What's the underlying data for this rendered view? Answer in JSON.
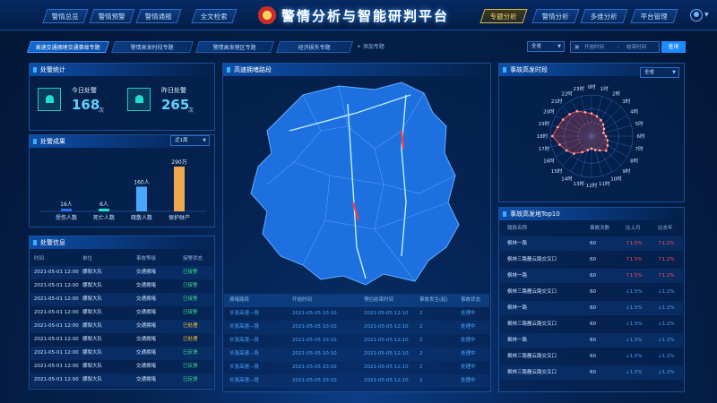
{
  "header": {
    "title": "警情分析与智能研判平台",
    "nav_left": [
      "警情总览",
      "警情预警",
      "警情通报",
      "全文检索"
    ],
    "nav_right": [
      "专题分析",
      "警情分析",
      "多维分析",
      "平台管理"
    ]
  },
  "tabs": [
    "高速交通拥堵交通事故专题",
    "警情高发时段专题",
    "警情高发辖区专题",
    "经济损失专题"
  ],
  "add_tab": "+ 添加专题",
  "filter": {
    "select": "全省",
    "start": "开始时间",
    "sep": "-",
    "end": "结束时间",
    "search": "查询"
  },
  "stats": {
    "title": "处警统计",
    "today_label": "今日处警",
    "today_value": "168",
    "today_unit": "次",
    "yesterday_label": "昨日处警",
    "yesterday_value": "265",
    "yesterday_unit": "次"
  },
  "results": {
    "title": "处警成果",
    "period": "近1周",
    "chart_data": {
      "type": "bar",
      "categories": [
        "受伤人数",
        "死亡人数",
        "疏散人数",
        "保护财产"
      ],
      "values": [
        16,
        6,
        160,
        290
      ],
      "labels": [
        "16人",
        "6人",
        "160人",
        "290万"
      ],
      "colors": [
        "#2f6df0",
        "#22e0d0",
        "#4aa6ff",
        "#f0a850"
      ]
    }
  },
  "info": {
    "title": "处警信息",
    "columns": [
      "时间",
      "单位",
      "事故等级",
      "接警状态"
    ],
    "rows": [
      [
        "2021-05-01 12:00",
        "娜梨大队",
        "交通拥堵",
        "已接警"
      ],
      [
        "2021-05-01 12:00",
        "娜梨大队",
        "交通拥堵",
        "已接警"
      ],
      [
        "2021-05-01 12:00",
        "娜梨大队",
        "交通拥堵",
        "已接警"
      ],
      [
        "2021-05-01 12:00",
        "娜梨大队",
        "交通拥堵",
        "已接警"
      ],
      [
        "2021-05-01 12:00",
        "娜梨大队",
        "交通拥堵",
        "已处理"
      ],
      [
        "2021-05-01 12:00",
        "娜梨大队",
        "交通拥堵",
        "已处理"
      ],
      [
        "2021-05-01 12:00",
        "娜梨大队",
        "交通拥堵",
        "已反馈"
      ],
      [
        "2021-05-01 12:00",
        "娜梨大队",
        "交通拥堵",
        "已反馈"
      ],
      [
        "2021-05-01 12:00",
        "娜梨大队",
        "交通拥堵",
        "已反馈"
      ]
    ],
    "status_colors": {
      "已接警": "#3ddc84",
      "已处理": "#ffcc33",
      "已反馈": "#3ddc84"
    }
  },
  "map": {
    "title": "高速拥堵路段",
    "columns": [
      "拥堵路段",
      "开始时间",
      "预估结束时间",
      "事故发生(起)",
      "事故状态"
    ],
    "rows": [
      [
        "长张高速—段",
        "2021-05-05 10:10",
        "2021-05-05 12:10",
        "2",
        "处理中"
      ],
      [
        "长张高速—段",
        "2021-05-05 10:10",
        "2021-05-05 12:10",
        "2",
        "处理中"
      ],
      [
        "长张高速—段",
        "2021-05-05 10:10",
        "2021-05-05 12:10",
        "2",
        "处理中"
      ],
      [
        "长张高速—段",
        "2021-05-05 10:10",
        "2021-05-05 12:10",
        "2",
        "处理中"
      ],
      [
        "长张高速—段",
        "2021-05-05 10:10",
        "2021-05-05 12:10",
        "2",
        "处理中"
      ],
      [
        "长张高速—段",
        "2021-05-05 10:10",
        "2021-05-05 12:10",
        "2",
        "处理中"
      ]
    ]
  },
  "radar": {
    "title": "事故高发时段",
    "select": "全省",
    "chart_data": {
      "type": "radar",
      "axes": [
        "0时",
        "1时",
        "2时",
        "3时",
        "4时",
        "5时",
        "6时",
        "7时",
        "8时",
        "9时",
        "10时",
        "11时",
        "12时",
        "13时",
        "14时",
        "15时",
        "16时",
        "17时",
        "18时",
        "19时",
        "20时",
        "21时",
        "22时",
        "23时"
      ],
      "values": [
        0.55,
        0.5,
        0.45,
        0.4,
        0.35,
        0.3,
        0.35,
        0.4,
        0.45,
        0.5,
        0.4,
        0.35,
        0.3,
        0.35,
        0.45,
        0.6,
        0.7,
        0.8,
        0.95,
        0.85,
        0.8,
        0.75,
        0.7,
        0.6
      ]
    }
  },
  "top10": {
    "title": "事故高发地Top10",
    "columns": [
      "路段名称",
      "事故次数",
      "比上月",
      "比去年"
    ],
    "rows": [
      [
        "枫林一路",
        "60",
        "↑1.5%",
        "↑1.2%",
        "up",
        "up"
      ],
      [
        "枫林三路麓云路交叉口",
        "60",
        "↑1.5%",
        "↑1.2%",
        "up",
        "up"
      ],
      [
        "枫林一路",
        "60",
        "↑1.5%",
        "↑1.2%",
        "up",
        "up"
      ],
      [
        "枫林三路麓云路交叉口",
        "60",
        "↓1.5%",
        "↓1.2%",
        "down",
        "down"
      ],
      [
        "枫林一路",
        "60",
        "↓1.5%",
        "↓1.2%",
        "down",
        "down"
      ],
      [
        "枫林三路麓云路交叉口",
        "60",
        "↓1.5%",
        "↓1.2%",
        "down",
        "down"
      ],
      [
        "枫林一路",
        "60",
        "↓1.5%",
        "↓1.2%",
        "down",
        "down"
      ],
      [
        "枫林三路麓云路交叉口",
        "60",
        "↓1.5%",
        "↓1.2%",
        "down",
        "down"
      ],
      [
        "枫林三路麓云路交叉口",
        "60",
        "↓1.5%",
        "↓1.2%",
        "down",
        "down"
      ]
    ],
    "trend_colors": {
      "up": "#ff4d4f",
      "down": "#4aa6ff"
    }
  }
}
